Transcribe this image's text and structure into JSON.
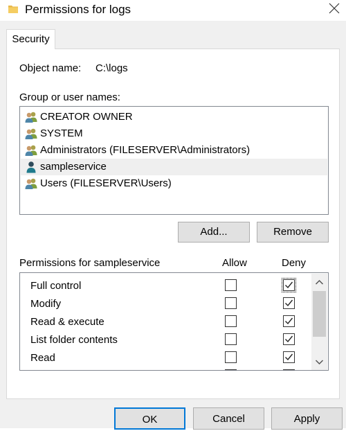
{
  "window": {
    "title": "Permissions for logs",
    "icon": "folder-icon",
    "close_icon": "close-icon"
  },
  "tabs": [
    {
      "label": "Security",
      "selected": true
    }
  ],
  "object": {
    "label": "Object name:",
    "value": "C:\\logs"
  },
  "groups": {
    "label": "Group or user names:",
    "items": [
      {
        "label": "CREATOR OWNER",
        "icon": "user-group-icon",
        "selected": false
      },
      {
        "label": "SYSTEM",
        "icon": "user-group-icon",
        "selected": false
      },
      {
        "label": "Administrators (FILESERVER\\Administrators)",
        "icon": "user-group-icon",
        "selected": false
      },
      {
        "label": "sampleservice",
        "icon": "user-icon",
        "selected": true
      },
      {
        "label": "Users (FILESERVER\\Users)",
        "icon": "user-group-icon",
        "selected": false
      }
    ]
  },
  "buttons": {
    "add": "Add...",
    "remove": "Remove",
    "ok": "OK",
    "cancel": "Cancel",
    "apply": "Apply"
  },
  "permissions": {
    "label": "Permissions for sampleservice",
    "allow_header": "Allow",
    "deny_header": "Deny",
    "rows": [
      {
        "name": "Full control",
        "allow": false,
        "deny": true
      },
      {
        "name": "Modify",
        "allow": false,
        "deny": true
      },
      {
        "name": "Read & execute",
        "allow": false,
        "deny": true
      },
      {
        "name": "List folder contents",
        "allow": false,
        "deny": true
      },
      {
        "name": "Read",
        "allow": false,
        "deny": true
      },
      {
        "name": "",
        "allow": false,
        "deny": false
      }
    ]
  },
  "colors": {
    "selected_row": "#efefef",
    "ok_border": "#0078d7",
    "dialog_bg": "#f0f0f0"
  }
}
